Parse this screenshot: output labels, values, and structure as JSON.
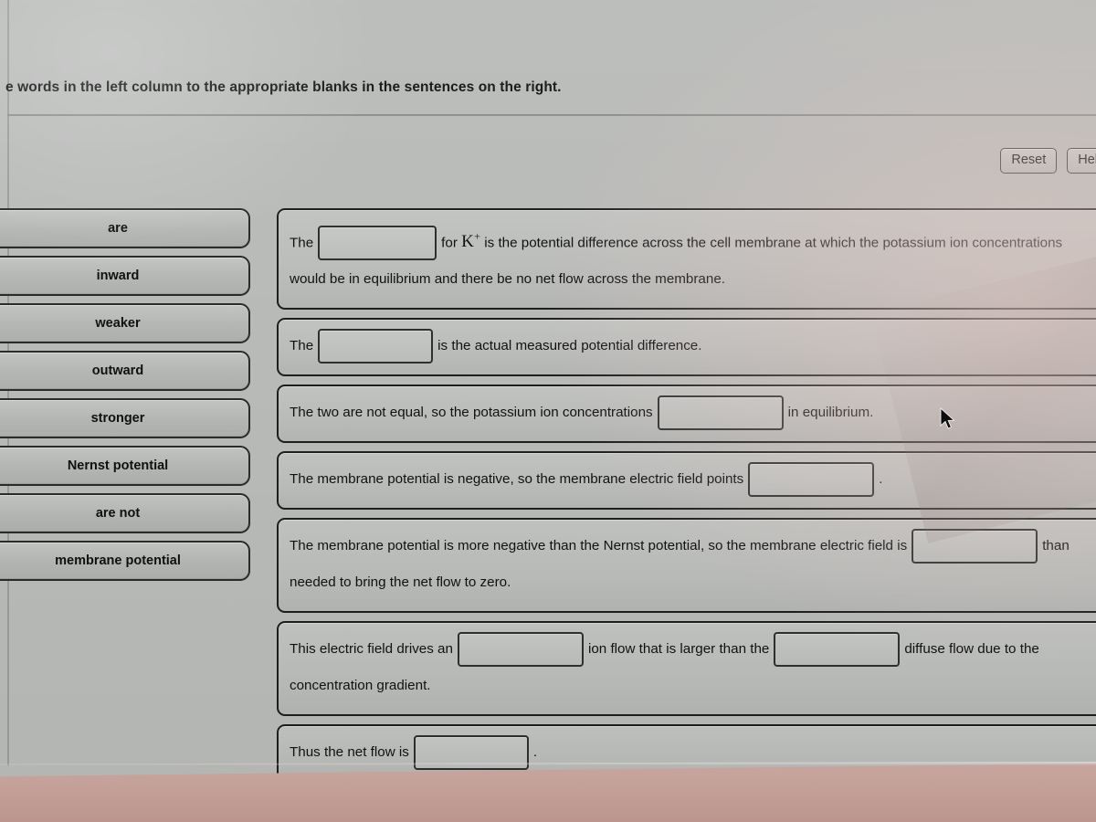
{
  "header": {
    "instruction": "e words in the left column to the appropriate blanks in the sentences on the right."
  },
  "toolbar": {
    "reset_label": "Reset",
    "help_label": "Hel"
  },
  "wordbank": {
    "items": [
      {
        "label": "are"
      },
      {
        "label": "inward"
      },
      {
        "label": "weaker"
      },
      {
        "label": "outward"
      },
      {
        "label": "stronger"
      },
      {
        "label": "Nernst potential"
      },
      {
        "label": "are not"
      },
      {
        "label": "membrane potential"
      }
    ]
  },
  "sentences": [
    {
      "id": "sentence-1",
      "before": "The",
      "mid": "for",
      "ion": "K",
      "ion_charge": "+",
      "after": "is the potential difference across the cell membrane at which the potassium ion concentrations would be in equilibrium and there be no net flow across the membrane.",
      "blank_value": ""
    },
    {
      "id": "sentence-2",
      "before": "The",
      "after": "is the actual measured potential difference.",
      "blank_value": ""
    },
    {
      "id": "sentence-3",
      "before": "The two are not equal, so the potassium ion concentrations",
      "after": "in equilibrium.",
      "blank_value": ""
    },
    {
      "id": "sentence-4",
      "before": "The membrane potential is negative, so the membrane electric field points",
      "after": ".",
      "blank_value": ""
    },
    {
      "id": "sentence-5",
      "before": "The membrane potential is more negative than the Nernst potential, so the membrane electric field is",
      "after": "than needed to bring the net flow to zero.",
      "blank_value": ""
    },
    {
      "id": "sentence-6",
      "before": "This electric field drives an",
      "mid": "ion flow that is larger than the",
      "after": "diffuse flow due to the concentration gradient.",
      "blank_value": "",
      "blank_value_2": ""
    },
    {
      "id": "sentence-7",
      "before": "Thus the net flow is",
      "after": ".",
      "blank_value": ""
    }
  ],
  "cursor": {
    "icon": "mouse-pointer-arrow"
  },
  "colors": {
    "screen_background": "#b9bbb9",
    "tile_fill": "#bcbebc",
    "border_dark": "#1d1f1e",
    "desk": "#c9a49d"
  }
}
